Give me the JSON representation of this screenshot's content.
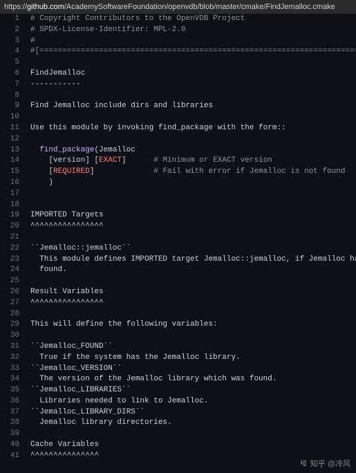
{
  "url": {
    "prefix": "https://",
    "domain": "github.com",
    "path": "/AcademySoftwareFoundation/openvdb/blob/master/cmake/FindJemalloc.cmake"
  },
  "lines": [
    {
      "n": 1,
      "segs": [
        {
          "t": "# Copyright Contributors to the OpenVDB Project",
          "c": "c-comment"
        }
      ]
    },
    {
      "n": 2,
      "segs": [
        {
          "t": "# SPDX-License-Identifier: MPL-2.0",
          "c": "c-comment"
        }
      ]
    },
    {
      "n": 3,
      "segs": [
        {
          "t": "#",
          "c": "c-comment"
        }
      ]
    },
    {
      "n": 4,
      "segs": [
        {
          "t": "#[=======================================================================[.rst:",
          "c": "c-comment"
        }
      ]
    },
    {
      "n": 5,
      "segs": []
    },
    {
      "n": 6,
      "segs": [
        {
          "t": "FindJemalloc",
          "c": ""
        }
      ]
    },
    {
      "n": 7,
      "segs": [
        {
          "t": "-----------",
          "c": ""
        }
      ]
    },
    {
      "n": 8,
      "segs": []
    },
    {
      "n": 9,
      "segs": [
        {
          "t": "Find Jemalloc include dirs and libraries",
          "c": ""
        }
      ]
    },
    {
      "n": 10,
      "segs": []
    },
    {
      "n": 11,
      "segs": [
        {
          "t": "Use this module by invoking find_package with the form::",
          "c": ""
        }
      ]
    },
    {
      "n": 12,
      "segs": []
    },
    {
      "n": 13,
      "segs": [
        {
          "t": "  ",
          "c": ""
        },
        {
          "t": "find_package",
          "c": "c-func"
        },
        {
          "t": "(Jemalloc",
          "c": ""
        }
      ]
    },
    {
      "n": 14,
      "segs": [
        {
          "t": "    [version] [",
          "c": ""
        },
        {
          "t": "EXACT",
          "c": "c-red"
        },
        {
          "t": "]      ",
          "c": ""
        },
        {
          "t": "# Minimum or EXACT version",
          "c": "c-comment"
        }
      ]
    },
    {
      "n": 15,
      "segs": [
        {
          "t": "    [",
          "c": ""
        },
        {
          "t": "REQUIRED",
          "c": "c-red"
        },
        {
          "t": "]             ",
          "c": ""
        },
        {
          "t": "# Fail with error if Jemalloc is not found",
          "c": "c-comment"
        }
      ]
    },
    {
      "n": 16,
      "segs": [
        {
          "t": "    )",
          "c": ""
        }
      ]
    },
    {
      "n": 17,
      "segs": []
    },
    {
      "n": 18,
      "segs": []
    },
    {
      "n": 19,
      "segs": [
        {
          "t": "IMPORTED Targets",
          "c": ""
        }
      ]
    },
    {
      "n": 20,
      "segs": [
        {
          "t": "^^^^^^^^^^^^^^^^",
          "c": ""
        }
      ]
    },
    {
      "n": 21,
      "segs": []
    },
    {
      "n": 22,
      "segs": [
        {
          "t": "``Jemalloc::jemalloc``",
          "c": ""
        }
      ]
    },
    {
      "n": 23,
      "segs": [
        {
          "t": "  This module defines IMPORTED target Jemalloc::jemalloc, if Jemalloc has been",
          "c": ""
        }
      ]
    },
    {
      "n": 24,
      "segs": [
        {
          "t": "  found.",
          "c": ""
        }
      ]
    },
    {
      "n": 25,
      "segs": []
    },
    {
      "n": 26,
      "segs": [
        {
          "t": "Result Variables",
          "c": ""
        }
      ]
    },
    {
      "n": 27,
      "segs": [
        {
          "t": "^^^^^^^^^^^^^^^^",
          "c": ""
        }
      ]
    },
    {
      "n": 28,
      "segs": []
    },
    {
      "n": 29,
      "segs": [
        {
          "t": "This will define the following variables:",
          "c": ""
        }
      ]
    },
    {
      "n": 30,
      "segs": []
    },
    {
      "n": 31,
      "segs": [
        {
          "t": "``Jemalloc_FOUND``",
          "c": ""
        }
      ]
    },
    {
      "n": 32,
      "segs": [
        {
          "t": "  True if the system has the Jemalloc library.",
          "c": ""
        }
      ]
    },
    {
      "n": 33,
      "segs": [
        {
          "t": "``Jemalloc_VERSION``",
          "c": ""
        }
      ]
    },
    {
      "n": 34,
      "segs": [
        {
          "t": "  The version of the Jemalloc library which was found.",
          "c": ""
        }
      ]
    },
    {
      "n": 35,
      "segs": [
        {
          "t": "``Jemalloc_LIBRARIES``",
          "c": ""
        }
      ]
    },
    {
      "n": 36,
      "segs": [
        {
          "t": "  Libraries needed to link to Jemalloc.",
          "c": ""
        }
      ]
    },
    {
      "n": 37,
      "segs": [
        {
          "t": "``Jemalloc_LIBRARY_DIRS``",
          "c": ""
        }
      ]
    },
    {
      "n": 38,
      "segs": [
        {
          "t": "  Jemalloc library directories.",
          "c": ""
        }
      ]
    },
    {
      "n": 39,
      "segs": []
    },
    {
      "n": 40,
      "segs": [
        {
          "t": "Cache Variables",
          "c": ""
        }
      ]
    },
    {
      "n": 41,
      "segs": [
        {
          "t": "^^^^^^^^^^^^^^^",
          "c": ""
        }
      ]
    }
  ],
  "watermark": {
    "text": "知乎 @冷风"
  }
}
